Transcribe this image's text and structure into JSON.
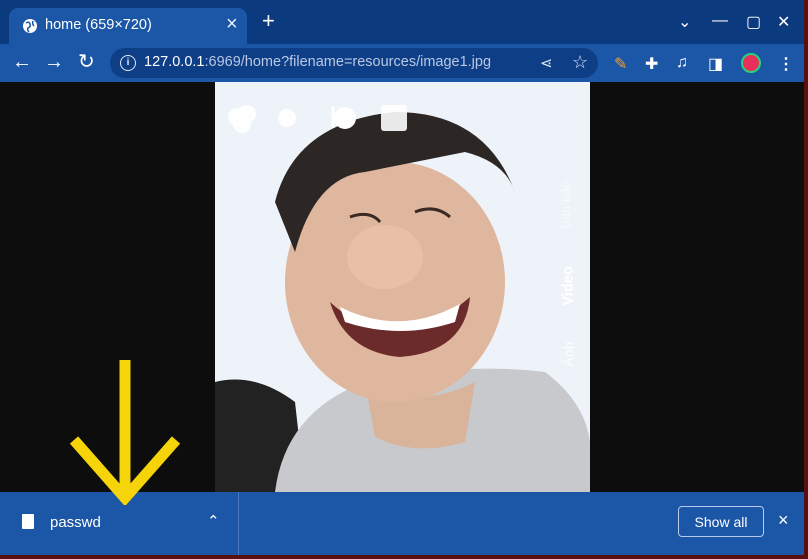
{
  "browser": {
    "tab_title": "home (659×720)",
    "new_tab": "+",
    "tab_close": "×",
    "url_main": "127.0.0.1",
    "url_rest": ":6969/home?filename=resources/image1.jpg",
    "window_controls": {
      "minimize": "⌄",
      "restore": "—",
      "maximize": "▢",
      "close": "✕"
    }
  },
  "photo_overlay": {
    "modes": [
      "Văn bản",
      "Video",
      "Ảnh"
    ],
    "active_mode": "Video"
  },
  "download_bar": {
    "file_name": "passwd",
    "show_all": "Show all",
    "close": "×"
  },
  "colors": {
    "title_bar": "#0b3a7e",
    "toolbar": "#1c56a6",
    "arrow": "#f5d40a"
  },
  "icons": [
    "globe-icon",
    "back-icon",
    "forward-icon",
    "reload-icon",
    "info-icon",
    "share-icon",
    "star-icon",
    "pen-icon",
    "extensions-icon",
    "playlist-icon",
    "sidepanel-icon",
    "profile-icon",
    "menu-icon",
    "file-icon",
    "chevron-up-icon",
    "close-icon"
  ]
}
